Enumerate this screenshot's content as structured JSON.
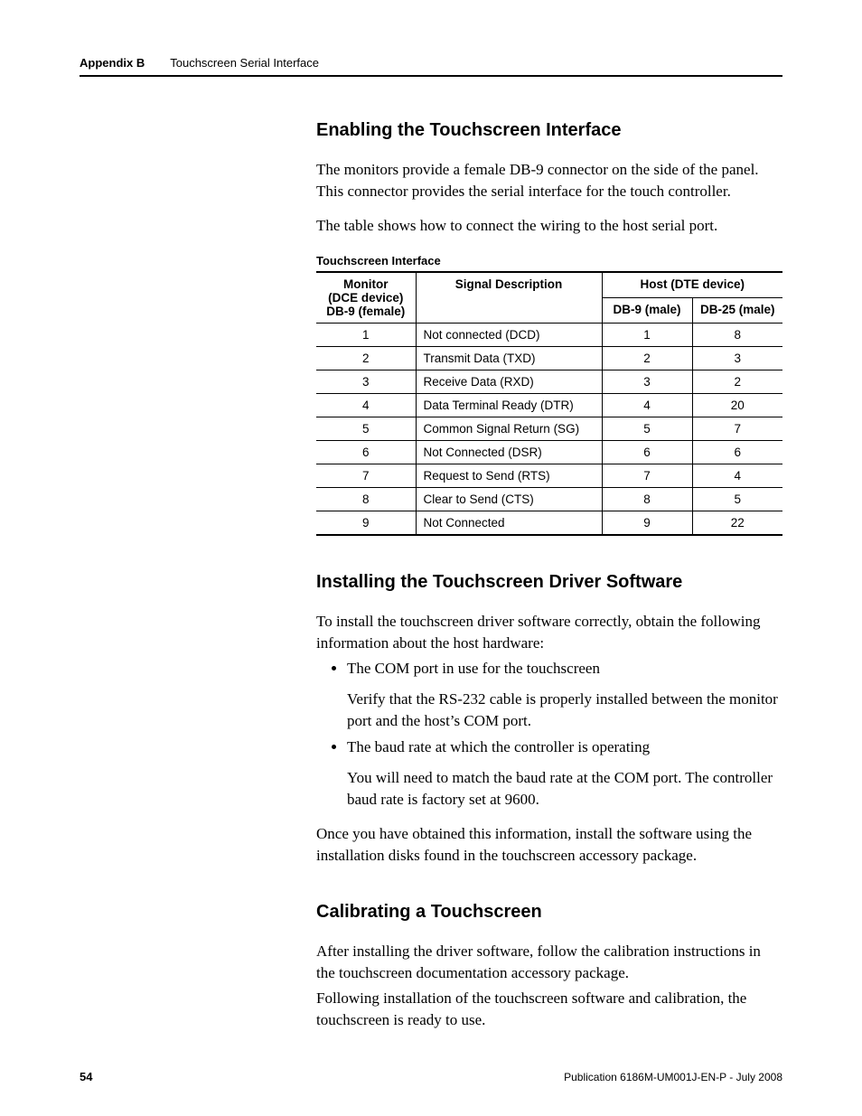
{
  "header": {
    "appendix": "Appendix B",
    "chapter": "Touchscreen Serial Interface"
  },
  "section1": {
    "title": "Enabling the Touchscreen Interface",
    "para1": "The monitors provide a female DB-9 connector on the side of the panel. This connector provides the serial interface for the touch controller.",
    "para2": "The table shows how to connect the wiring to the host serial port.",
    "tableTitle": "Touchscreen Interface",
    "table": {
      "head": {
        "monitor_l1": "Monitor",
        "monitor_l2": "(DCE device)",
        "monitor_l3": "DB-9 (female)",
        "signal": "Signal Description",
        "host": "Host (DTE device)",
        "db9": "DB-9 (male)",
        "db25": "DB-25 (male)"
      },
      "rows": [
        {
          "monitor": "1",
          "signal": "Not connected (DCD)",
          "db9": "1",
          "db25": "8"
        },
        {
          "monitor": "2",
          "signal": "Transmit Data (TXD)",
          "db9": "2",
          "db25": "3"
        },
        {
          "monitor": "3",
          "signal": "Receive Data (RXD)",
          "db9": "3",
          "db25": "2"
        },
        {
          "monitor": "4",
          "signal": "Data Terminal Ready (DTR)",
          "db9": "4",
          "db25": "20"
        },
        {
          "monitor": "5",
          "signal": "Common Signal Return (SG)",
          "db9": "5",
          "db25": "7"
        },
        {
          "monitor": "6",
          "signal": "Not Connected (DSR)",
          "db9": "6",
          "db25": "6"
        },
        {
          "monitor": "7",
          "signal": "Request to Send (RTS)",
          "db9": "7",
          "db25": "4"
        },
        {
          "monitor": "8",
          "signal": "Clear to Send (CTS)",
          "db9": "8",
          "db25": "5"
        },
        {
          "monitor": "9",
          "signal": "Not Connected",
          "db9": "9",
          "db25": "22"
        }
      ]
    }
  },
  "section2": {
    "title": "Installing the Touchscreen Driver Software",
    "intro": "To install the touchscreen driver software correctly, obtain the following information about the host hardware:",
    "bullets": [
      {
        "lead": "The COM port in use for the touchscreen",
        "sub": "Verify that the RS-232 cable is properly installed between the monitor port and the host’s COM port."
      },
      {
        "lead": "The baud rate at which the controller is operating",
        "sub": "You will need to match the baud rate at the COM port. The controller baud rate is factory set at 9600."
      }
    ],
    "outro": "Once you have obtained this information, install the software using the installation disks found in the touchscreen accessory package."
  },
  "section3": {
    "title": "Calibrating a Touchscreen",
    "para1": "After installing the driver software, follow the calibration instructions in the touchscreen documentation accessory package.",
    "para2": "Following installation of the touchscreen software and calibration, the touchscreen is ready to use."
  },
  "footer": {
    "page": "54",
    "publication": "Publication 6186M-UM001J-EN-P - July 2008"
  }
}
